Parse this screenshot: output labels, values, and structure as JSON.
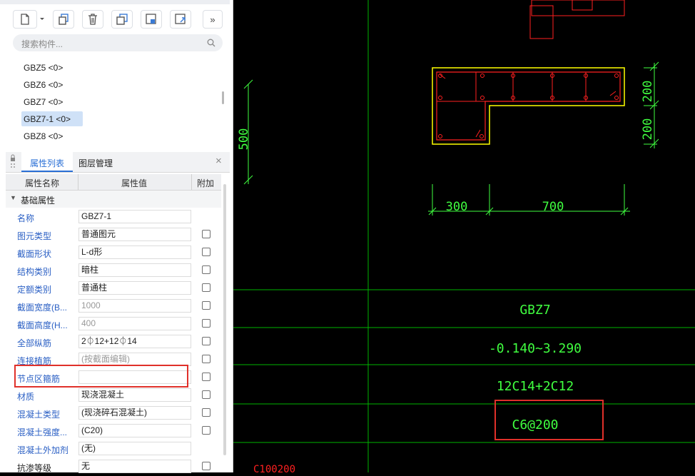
{
  "toolbar": {
    "buttons": [
      {
        "name": "new-component-button",
        "icon": "new-file-icon"
      },
      {
        "name": "dropdown-arrow-button",
        "icon": "chevron-down-icon"
      },
      {
        "name": "copy-button",
        "icon": "copy-icon"
      },
      {
        "name": "delete-button",
        "icon": "trash-icon"
      },
      {
        "name": "duplicate-button",
        "icon": "layers-icon"
      },
      {
        "name": "import-button",
        "icon": "import-icon"
      },
      {
        "name": "export-button",
        "icon": "export-icon"
      },
      {
        "name": "more-button",
        "icon": "double-chevron-right-icon",
        "label": "»"
      }
    ]
  },
  "search": {
    "placeholder": "搜索构件..."
  },
  "components": {
    "items": [
      "GBZ5 <0>",
      "GBZ6 <0>",
      "GBZ7 <0>",
      "GBZ7-1 <0>",
      "GBZ8 <0>"
    ],
    "selected": "GBZ7-1 <0>"
  },
  "properties_panel": {
    "tabs": [
      {
        "label": "属性列表",
        "active": true
      },
      {
        "label": "图层管理",
        "active": false
      }
    ],
    "close": "×",
    "columns": {
      "name": "属性名称",
      "value": "属性值",
      "extra": "附加"
    },
    "group": "基础属性",
    "rows": [
      {
        "name": "名称",
        "value": "GBZ7-1",
        "checkbox": false,
        "link": true
      },
      {
        "name": "图元类型",
        "value": "普通图元",
        "checkbox": true,
        "link": true
      },
      {
        "name": "截面形状",
        "value": "L-d形",
        "checkbox": true,
        "link": true
      },
      {
        "name": "结构类别",
        "value": "暗柱",
        "checkbox": true,
        "link": true
      },
      {
        "name": "定额类别",
        "value": "普通柱",
        "checkbox": true,
        "link": true
      },
      {
        "name": "截面宽度(B...",
        "value": "1000",
        "checkbox": true,
        "link": true,
        "grey": true
      },
      {
        "name": "截面高度(H...",
        "value": "400",
        "checkbox": true,
        "link": true,
        "grey": true
      },
      {
        "name": "全部纵筋",
        "value": "2⏀12+12⏀14",
        "checkbox": true,
        "link": true
      },
      {
        "name": "连接植筋",
        "value": "(按截面编辑)",
        "checkbox": true,
        "link": true,
        "grey": true
      },
      {
        "name": "节点区箍筋",
        "value": "",
        "checkbox": true,
        "link": true
      },
      {
        "name": "材质",
        "value": "现浇混凝土",
        "checkbox": true,
        "link": true
      },
      {
        "name": "混凝土类型",
        "value": "(现浇碎石混凝土)",
        "checkbox": true,
        "link": true
      },
      {
        "name": "混凝土强度...",
        "value": "(C20)",
        "checkbox": true,
        "link": true
      },
      {
        "name": "混凝土外加剂",
        "value": "(无)",
        "checkbox": false,
        "link": true
      },
      {
        "name": "抗渗等级",
        "value": "无",
        "checkbox": true,
        "link": false
      }
    ]
  },
  "cad": {
    "dims": {
      "height_total": "500",
      "height_top": "200",
      "height_bottom": "200",
      "width_left": "300",
      "width_right": "700"
    },
    "table": {
      "name": "GBZ7",
      "elevation": "-0.140~3.290",
      "longitudinal": "12C14+2C12",
      "stirrup": "C6@200",
      "bottom_partial": "C100200"
    },
    "colors": {
      "background": "#000000",
      "grid": "#00c000",
      "text": "#40ff40",
      "rebar": "#ff2020",
      "outline": "#ffff00",
      "highlight": "#e0302a"
    }
  }
}
